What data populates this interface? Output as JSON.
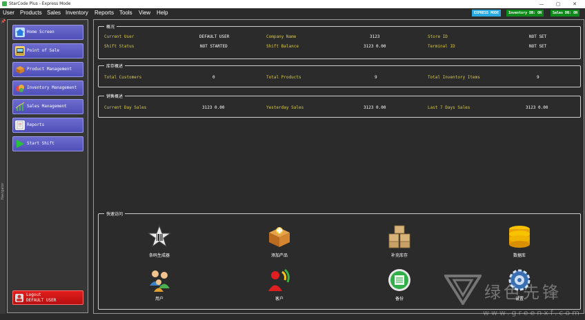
{
  "window": {
    "title": "StarCode Plus - Express Mode",
    "min": "—",
    "max": "▢",
    "close": "✕"
  },
  "menu": [
    "User",
    "Products",
    "Sales",
    "Inventory",
    "Reports",
    "Tools",
    "View",
    "Help"
  ],
  "status": {
    "express": "EXPRESS MODE",
    "inventory_db": "Inventory DB: ON",
    "sales_db": "Sales DB: ON",
    "express_color": "#29a9e0",
    "db_color": "#0d8a1a"
  },
  "navstrip": {
    "label": "Navigator"
  },
  "sidebar": {
    "items": [
      {
        "label": "Home Screen",
        "icon": "home-icon"
      },
      {
        "label": "Point of Sale",
        "icon": "pos-icon"
      },
      {
        "label": "Product Management",
        "icon": "box-icon"
      },
      {
        "label": "Inventory Management",
        "icon": "inventory-icon"
      },
      {
        "label": "Sales Management",
        "icon": "chart-icon"
      },
      {
        "label": "Reports",
        "icon": "report-icon"
      },
      {
        "label": "Start Shift",
        "icon": "play-icon"
      }
    ],
    "logout": {
      "line1": "Logout",
      "line2": "DEFAULT USER"
    }
  },
  "overview": {
    "title": "概况",
    "current_user_label": "Current User",
    "current_user": "DEFAULT USER",
    "company_label": "Company Name",
    "company": "3123",
    "store_label": "Store ID",
    "store": "NOT SET",
    "shift_status_label": "Shift Status",
    "shift_status": "NOT STARTED",
    "shift_balance_label": "Shift Balance",
    "shift_balance": "3123 0.00",
    "terminal_label": "Terminal ID",
    "terminal": "NOT SET"
  },
  "inventory": {
    "title": "库存概述",
    "customers_label": "Total Customers",
    "customers": "0",
    "products_label": "Total Products",
    "products": "9",
    "items_label": "Total Inventory Items",
    "items": "9"
  },
  "sales": {
    "title": "销售概述",
    "current_label": "Current Day Sales",
    "current": "3123 0.00",
    "yesterday_label": "Yesterday Sales",
    "yesterday": "3123 0.00",
    "last7_label": "Last 7 Days Sales",
    "last7": "3123 0.00"
  },
  "quick": {
    "title": "快速访问",
    "items": [
      {
        "label": "条码生成器",
        "icon": "barcode-star-icon"
      },
      {
        "label": "添加产品",
        "icon": "add-product-icon"
      },
      {
        "label": "补充库存",
        "icon": "restock-icon"
      },
      {
        "label": "数据库",
        "icon": "database-icon"
      },
      {
        "label": "用户",
        "icon": "users-icon"
      },
      {
        "label": "客户",
        "icon": "customers-icon"
      },
      {
        "label": "备份",
        "icon": "backup-icon"
      },
      {
        "label": "设置",
        "icon": "settings-icon"
      }
    ]
  },
  "watermark": {
    "text": "绿色先锋",
    "url": "www.greenxf.com"
  }
}
